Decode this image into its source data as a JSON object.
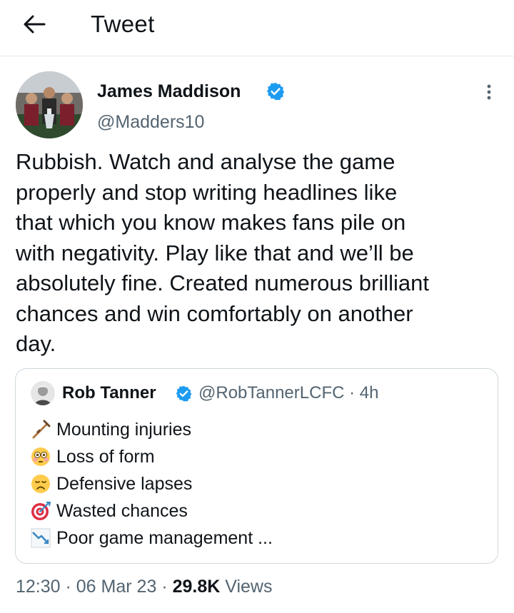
{
  "header": {
    "title": "Tweet",
    "back_icon": "arrow-left-icon"
  },
  "tweet": {
    "author_name": "James Maddison",
    "handle": "@Madders10",
    "verified_color": "#1d9bf0",
    "text": "Rubbish. Watch and analyse the game\nproperly and stop writing headlines like\nthat which you know makes fans pile on\nwith negativity. Play like that and we’ll be\nabsolutely fine. Created numerous brilliant\nchances and win comfortably on another\nday."
  },
  "quote": {
    "author_name": "Rob Tanner",
    "handle_time": "@RobTannerLCFC · 4h",
    "lines": [
      {
        "icon": "crutch-icon",
        "text": "Mounting injuries"
      },
      {
        "icon": "flushed-face-icon",
        "text": "Loss of form"
      },
      {
        "icon": "disappointed-face-icon",
        "text": "Defensive lapses"
      },
      {
        "icon": "direct-hit-icon",
        "text": "Wasted chances"
      },
      {
        "icon": "chart-decreasing-icon",
        "text": "Poor game management ..."
      }
    ]
  },
  "meta": {
    "time": "12:30",
    "sep1": " · ",
    "date": "06 Mar 23",
    "sep2": " · ",
    "views_count": "29.8K",
    "views_label": " Views"
  },
  "colors": {
    "accent": "#1d9bf0",
    "text": "#0f1419",
    "secondary": "#536471",
    "border": "#cfd9de"
  }
}
